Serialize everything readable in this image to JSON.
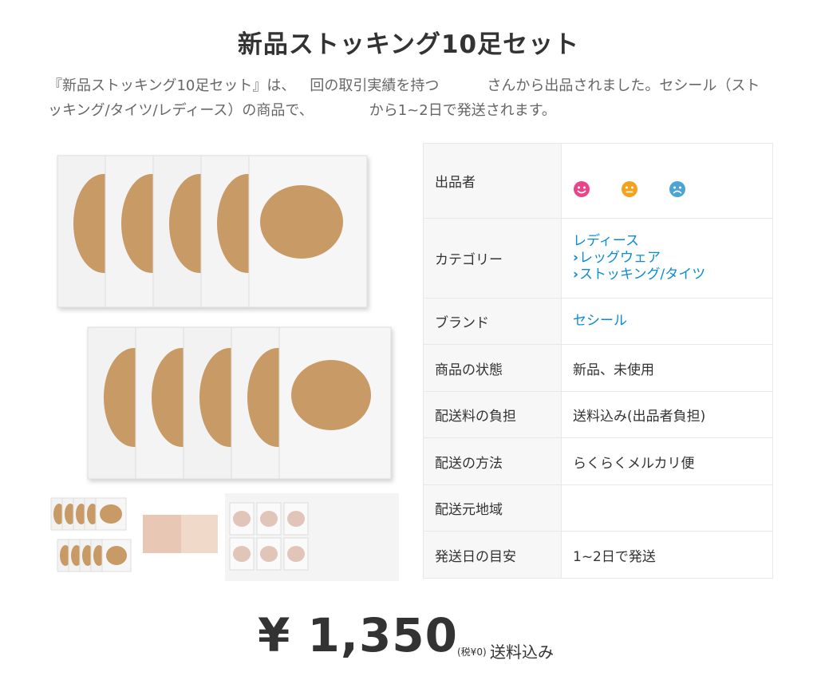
{
  "title": "新品ストッキング10足セット",
  "description": {
    "part1": "『新品ストッキング10足セット』は、",
    "part2": "回の取引実績を持つ",
    "part3": "さんから出品されました。セシール（ストッキング/タイツ/レディース）の商品で、",
    "part4": "から1~2日で発送されます。"
  },
  "specs": {
    "seller_label": "出品者",
    "category_label": "カテゴリー",
    "category_items": [
      "レディース",
      "レッグウェア",
      "ストッキング/タイツ"
    ],
    "brand_label": "ブランド",
    "brand_value": "セシール",
    "condition_label": "商品の状態",
    "condition_value": "新品、未使用",
    "shipping_fee_label": "配送料の負担",
    "shipping_fee_value": "送料込み(出品者負担)",
    "shipping_method_label": "配送の方法",
    "shipping_method_value": "らくらくメルカリ便",
    "ship_from_label": "配送元地域",
    "ship_from_value": "",
    "ship_days_label": "発送日の目安",
    "ship_days_value": "1~2日で発送"
  },
  "rating_colors": {
    "good": "#e8458b",
    "normal": "#f4a21c",
    "bad": "#4ca3d6"
  },
  "price": {
    "amount": "¥ 1,350",
    "tax": "(税¥0)",
    "shipping": "送料込み"
  }
}
